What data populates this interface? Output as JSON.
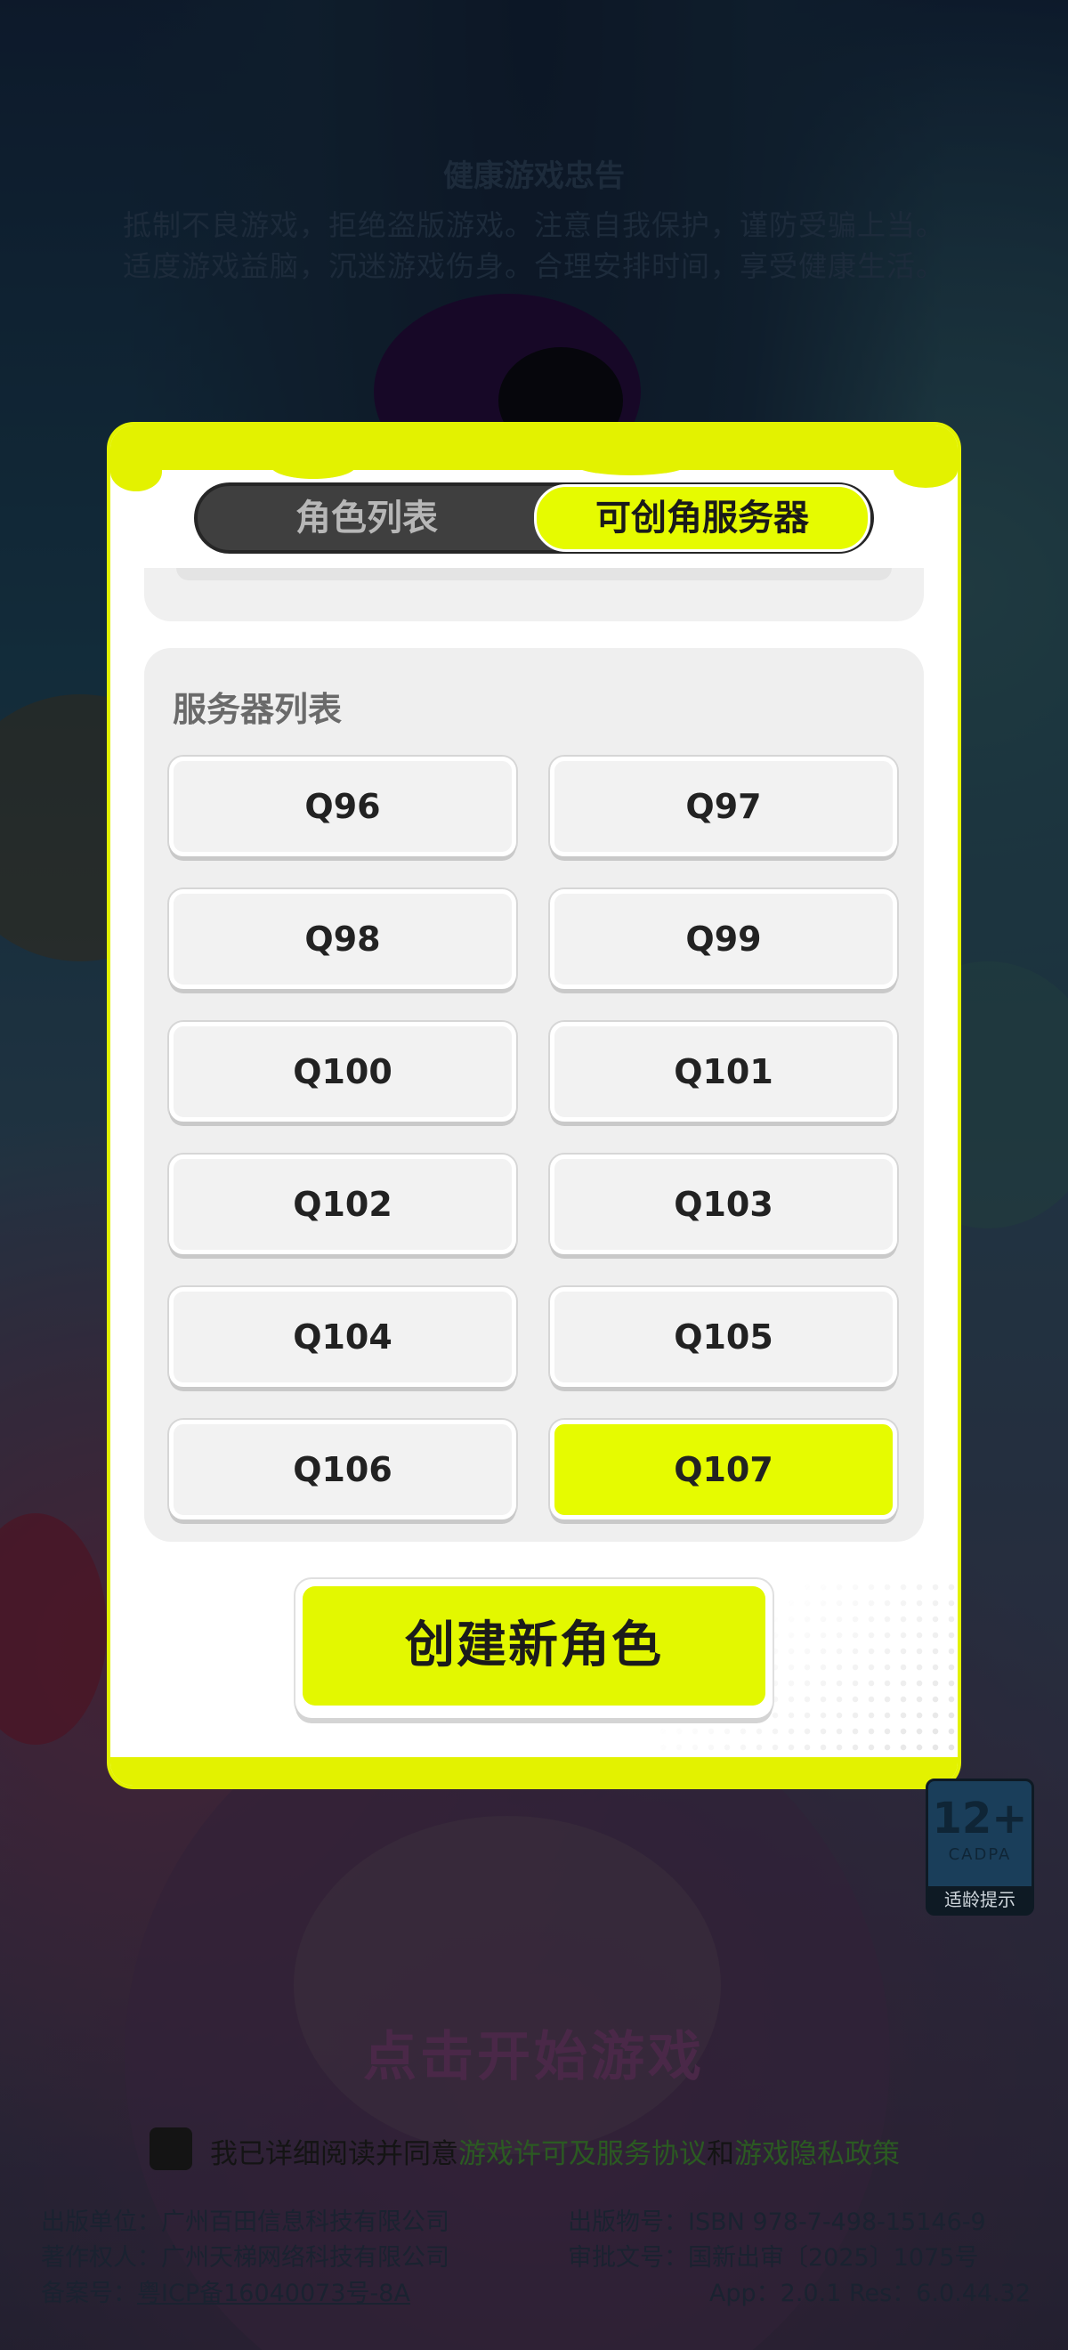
{
  "health_notice": {
    "title": "健康游戏忠告",
    "line1": "抵制不良游戏，拒绝盗版游戏。注意自我保护，谨防受骗上当。",
    "line2": "适度游戏益脑，沉迷游戏伤身。合理安排时间，享受健康生活。"
  },
  "modal": {
    "tabs": {
      "roles_label": "角色列表",
      "servers_label": "可创角服务器",
      "active": "servers"
    },
    "server_panel_title": "服务器列表",
    "servers": [
      {
        "label": "Q96",
        "selected": false
      },
      {
        "label": "Q97",
        "selected": false
      },
      {
        "label": "Q98",
        "selected": false
      },
      {
        "label": "Q99",
        "selected": false
      },
      {
        "label": "Q100",
        "selected": false
      },
      {
        "label": "Q101",
        "selected": false
      },
      {
        "label": "Q102",
        "selected": false
      },
      {
        "label": "Q103",
        "selected": false
      },
      {
        "label": "Q104",
        "selected": false
      },
      {
        "label": "Q105",
        "selected": false
      },
      {
        "label": "Q106",
        "selected": false
      },
      {
        "label": "Q107",
        "selected": true
      }
    ],
    "create_button_label": "创建新角色",
    "accent_color": "#e6fb00"
  },
  "age_rating": {
    "number": "12+",
    "org": "CADPA",
    "tip": "适龄提示"
  },
  "start_prompt": "点击开始游戏",
  "agreement": {
    "prefix": "我已详细阅读并同意",
    "link1": "游戏许可及服务协议",
    "and": "和",
    "link2": "游戏隐私政策"
  },
  "footer": {
    "publisher": "出版单位：广州百田信息科技有限公司",
    "copyright_owner": "著作权人：广州天梯网络科技有限公司",
    "filing_prefix": "备案号：",
    "filing_link": "粤ICP备16040073号-8A",
    "publication": "出版物号：ISBN 978-7-498-15146-9",
    "approval": "审批文号：国新出审〔2025〕1075号",
    "version": "App：2.0.1  Res：6.0.44.32"
  }
}
